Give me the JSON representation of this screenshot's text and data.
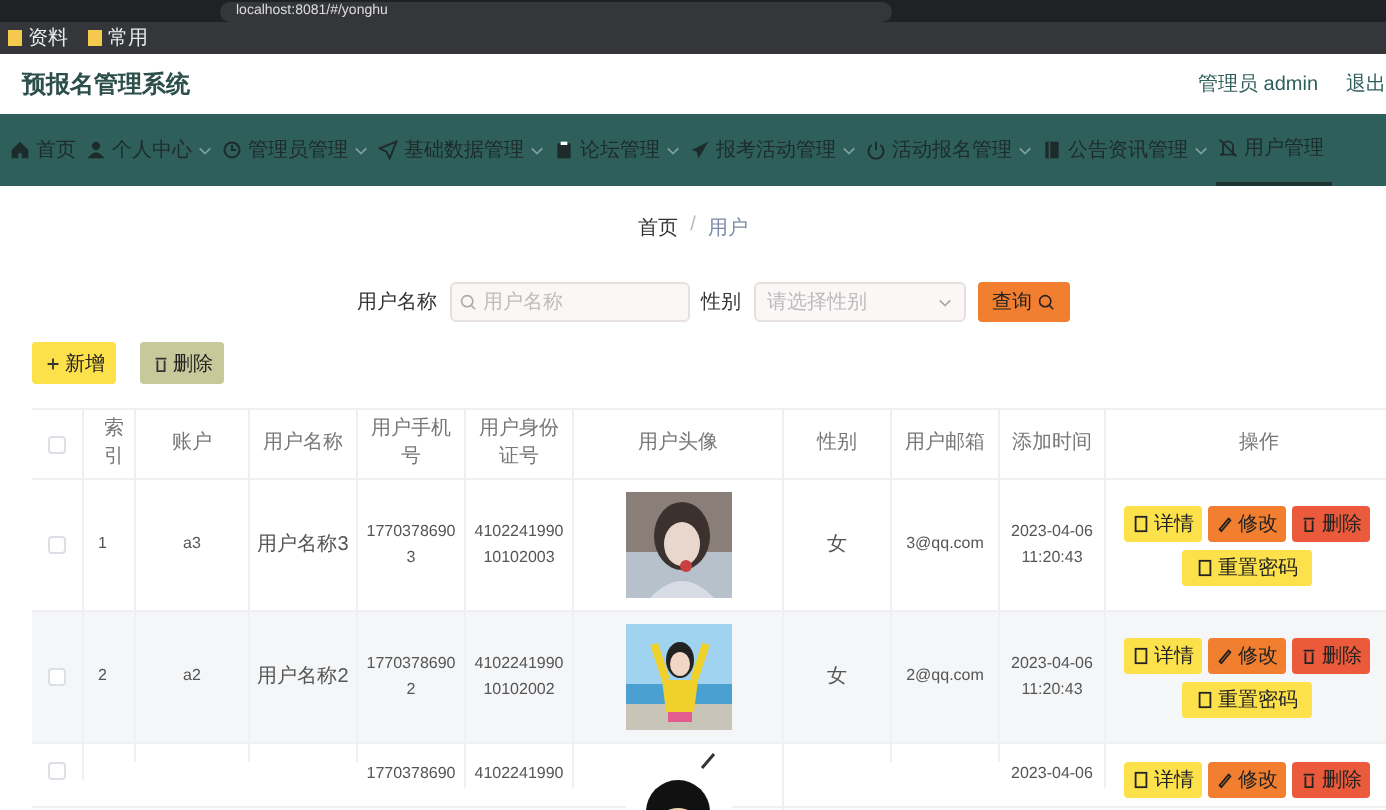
{
  "browser": {
    "url": "localhost:8081/#/yonghu",
    "bookmarks": [
      "资料",
      "常用"
    ]
  },
  "header": {
    "title": "预报名管理系统",
    "user": "管理员 admin",
    "logout": "退出"
  },
  "nav": [
    {
      "label": "首页",
      "dropdown": false,
      "selected": false
    },
    {
      "label": "个人中心",
      "dropdown": true,
      "selected": false
    },
    {
      "label": "管理员管理",
      "dropdown": true,
      "selected": false
    },
    {
      "label": "基础数据管理",
      "dropdown": true,
      "selected": false
    },
    {
      "label": "论坛管理",
      "dropdown": true,
      "selected": false
    },
    {
      "label": "报考活动管理",
      "dropdown": true,
      "selected": false
    },
    {
      "label": "活动报名管理",
      "dropdown": true,
      "selected": false
    },
    {
      "label": "公告资讯管理",
      "dropdown": true,
      "selected": false
    },
    {
      "label": "用户管理",
      "dropdown": false,
      "selected": true
    }
  ],
  "breadcrumb": [
    "首页",
    "用户"
  ],
  "breadcrumb_separator": "/",
  "search": {
    "fields": [
      {
        "kind": "text",
        "label": "用户名称",
        "placeholder": "用户名称"
      },
      {
        "kind": "select",
        "label": "性别",
        "placeholder": "请选择性别"
      }
    ],
    "button": "查询"
  },
  "actions": [
    {
      "kind": "add",
      "label": "新增"
    },
    {
      "kind": "delete",
      "label": "删除"
    }
  ],
  "table": {
    "select_all": false,
    "columns": [
      "索引",
      "账户",
      "用户名称",
      "用户手机号",
      "用户身份证号",
      "用户头像",
      "性别",
      "用户邮箱",
      "添加时间",
      "操作"
    ],
    "rows": [
      {
        "checked": false,
        "index": "1",
        "account": "a3",
        "name": "用户名称3",
        "phone": "17703786903",
        "id_number": "410224199010102003",
        "avatar": {
          "kind": "picture"
        },
        "gender": "女",
        "email": "3@qq.com",
        "added": "2023-04-06 11:20:43",
        "buttons": [
          {
            "kind": "detail",
            "label": "详情"
          },
          {
            "kind": "edit",
            "label": "修改"
          },
          {
            "kind": "delete",
            "label": "删除"
          },
          {
            "kind": "reset",
            "label": "重置密码"
          }
        ]
      },
      {
        "checked": false,
        "index": "2",
        "account": "a2",
        "name": "用户名称2",
        "phone": "17703786902",
        "id_number": "410224199010102002",
        "avatar": {
          "kind": "picture"
        },
        "gender": "女",
        "email": "2@qq.com",
        "added": "2023-04-06 11:20:43",
        "buttons": [
          {
            "kind": "detail",
            "label": "详情"
          },
          {
            "kind": "edit",
            "label": "修改"
          },
          {
            "kind": "delete",
            "label": "删除"
          },
          {
            "kind": "reset",
            "label": "重置密码"
          }
        ]
      },
      {
        "checked": false,
        "phone": "1770378690",
        "id_number": "4102241990",
        "avatar": {
          "kind": "picture"
        },
        "added": "2023-04-06",
        "buttons": [
          {
            "kind": "detail",
            "label": "详情"
          },
          {
            "kind": "edit",
            "label": "修改"
          },
          {
            "kind": "delete",
            "label": "删除"
          }
        ]
      }
    ]
  }
}
